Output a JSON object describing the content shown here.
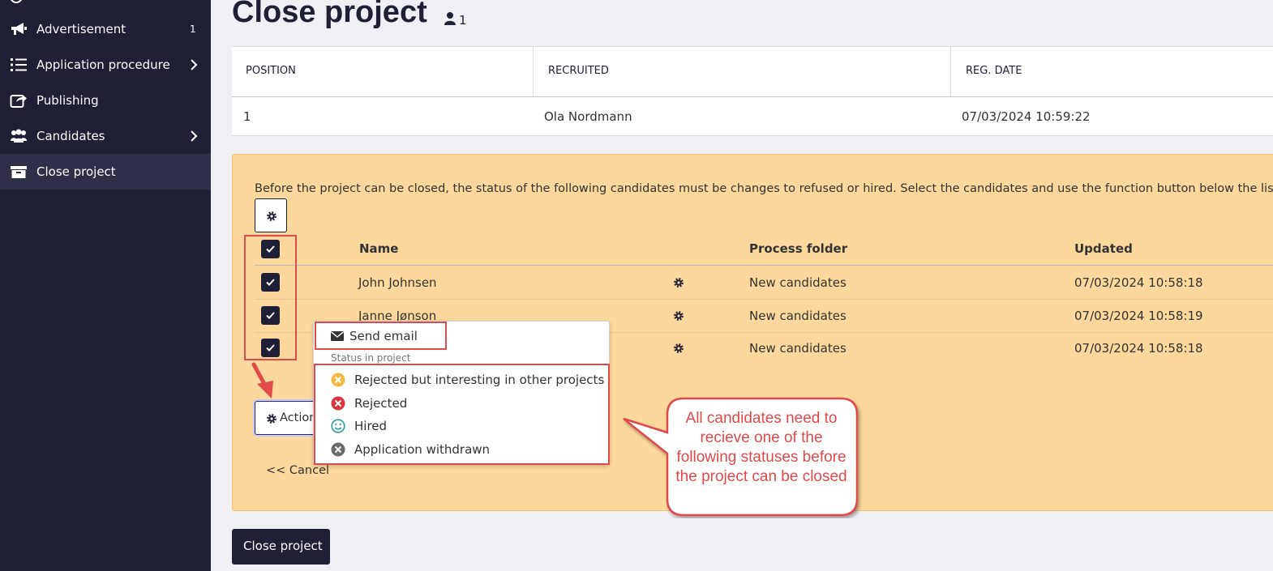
{
  "sidebar": {
    "items": [
      {
        "label": "Advertisement",
        "badge": "1",
        "icon": "megaphone-icon"
      },
      {
        "label": "Application procedure",
        "icon": "list-icon"
      },
      {
        "label": "Publishing",
        "icon": "share-icon"
      },
      {
        "label": "Candidates",
        "icon": "users-icon"
      },
      {
        "label": "Close project",
        "icon": "archive-icon"
      }
    ]
  },
  "page": {
    "title": "Close project",
    "user_count": "1"
  },
  "top_table": {
    "headers": [
      "POSITION",
      "RECRUITED",
      "REG. DATE"
    ],
    "row": [
      "1",
      "Ola Nordmann",
      "07/03/2024 10:59:22"
    ]
  },
  "panel": {
    "info": "Before the project can be closed, the status of the following candidates must be changes to refused or hired. Select the candidates and use the function button below the list.",
    "headers": [
      "Name",
      "Process folder",
      "Updated"
    ],
    "rows": [
      {
        "name": "John Johnsen",
        "folder": "New candidates",
        "updated": "07/03/2024 10:58:18"
      },
      {
        "name": "Janne Jønson",
        "folder": "New candidates",
        "updated": "07/03/2024 10:58:19"
      },
      {
        "name": "",
        "folder": "New candidates",
        "updated": "07/03/2024 10:58:18"
      }
    ],
    "actions_label": "Action",
    "cancel_label": "<< Cancel"
  },
  "dropdown": {
    "send_email": "Send email",
    "section_label": "Status in project",
    "statuses": [
      {
        "label": "Rejected but interesting in other projects",
        "color": "#f5b942"
      },
      {
        "label": "Rejected",
        "color": "#d9363e"
      },
      {
        "label": "Hired",
        "color": "#2aa198"
      },
      {
        "label": "Application withdrawn",
        "color": "#6b6b6b"
      }
    ]
  },
  "callout": {
    "text": "All candidates need to recieve one of the following statuses before the project can be closed"
  },
  "close_button": "Close project",
  "colors": {
    "sidebar": "#1f1f35",
    "panel": "#fdd89d",
    "annotation": "#e04a4a"
  }
}
